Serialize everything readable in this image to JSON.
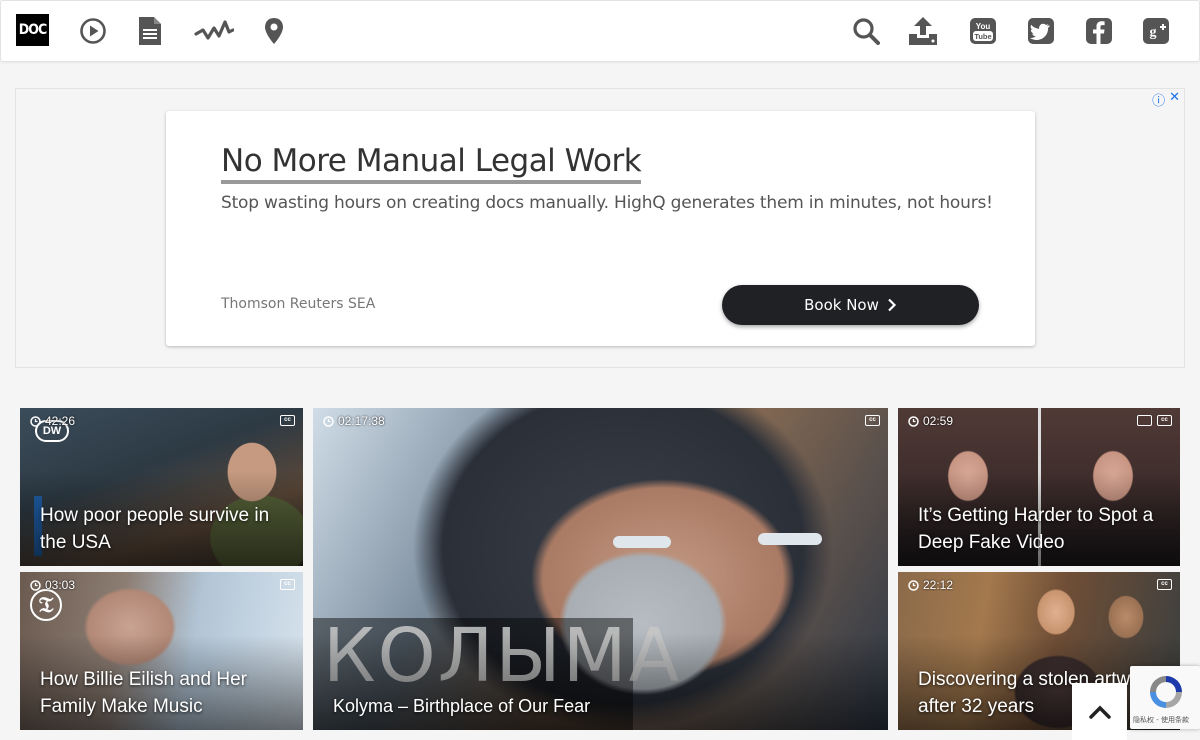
{
  "header": {
    "logo": "DOC",
    "nav_icons": [
      "play-icon",
      "document-icon",
      "activity-icon",
      "location-icon"
    ],
    "right_icons": [
      "search-icon",
      "upload-icon",
      "youtube-icon",
      "twitter-icon",
      "facebook-icon",
      "google-plus-icon"
    ]
  },
  "ad": {
    "title": "No More Manual Legal Work",
    "description": "Stop wasting hours on creating docs manually. HighQ generates them in minutes, not hours!",
    "sponsor": "Thomson Reuters SEA",
    "button_label": "Book Now",
    "choices": [
      "ⓘ",
      "✕"
    ]
  },
  "videos": [
    {
      "duration": "42:26",
      "title": "How poor people survive in the USA",
      "badge": "DW"
    },
    {
      "duration": "02:17:38",
      "title": "Kolyma – Birthplace of Our Fear",
      "overlay_text": "КОЛЫМА"
    },
    {
      "duration": "02:59",
      "title": "It’s Getting Harder to Spot a Deep Fake Video"
    },
    {
      "duration": "03:03",
      "title": "How Billie Eilish and Her Family Make Music"
    },
    {
      "duration": "22:12",
      "title": "Discovering a stolen artwork after 32 years"
    }
  ],
  "recaptcha": {
    "footer": "隐私权 - 使用条款"
  },
  "colors": {
    "accent": "#202124",
    "ad_choice": "#1a73e8"
  }
}
